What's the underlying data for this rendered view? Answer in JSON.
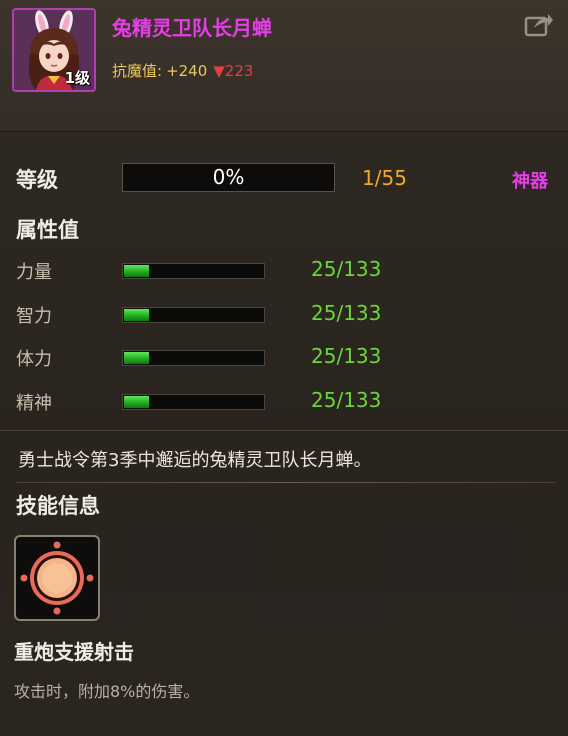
{
  "hero": {
    "name": "兔精灵卫队长月蝉",
    "level_badge": "1级",
    "stat_label": "抗魔值:",
    "stat_plus": "+240",
    "stat_down": "▼223"
  },
  "level": {
    "label": "等级",
    "percent": "0%",
    "progress": 0,
    "count": "1/55",
    "artifact_label": "神器"
  },
  "attributes": {
    "title": "属性值",
    "items": [
      {
        "name": "力量",
        "value": "25/133",
        "fraction": 0.188
      },
      {
        "name": "智力",
        "value": "25/133",
        "fraction": 0.188
      },
      {
        "name": "体力",
        "value": "25/133",
        "fraction": 0.188
      },
      {
        "name": "精神",
        "value": "25/133",
        "fraction": 0.188
      }
    ]
  },
  "description": "勇士战令第3季中邂逅的兔精灵卫队长月蝉。",
  "skill": {
    "title": "技能信息",
    "name": "重炮支援射击",
    "description": "攻击时，附加8%的伤害。",
    "icon": "cannon-target-icon"
  },
  "colors": {
    "name_magenta": "#e63ee6",
    "stat_gold": "#e8c860",
    "down_red": "#e04040",
    "count_orange": "#f0a830",
    "attr_green": "#6ad63a"
  }
}
